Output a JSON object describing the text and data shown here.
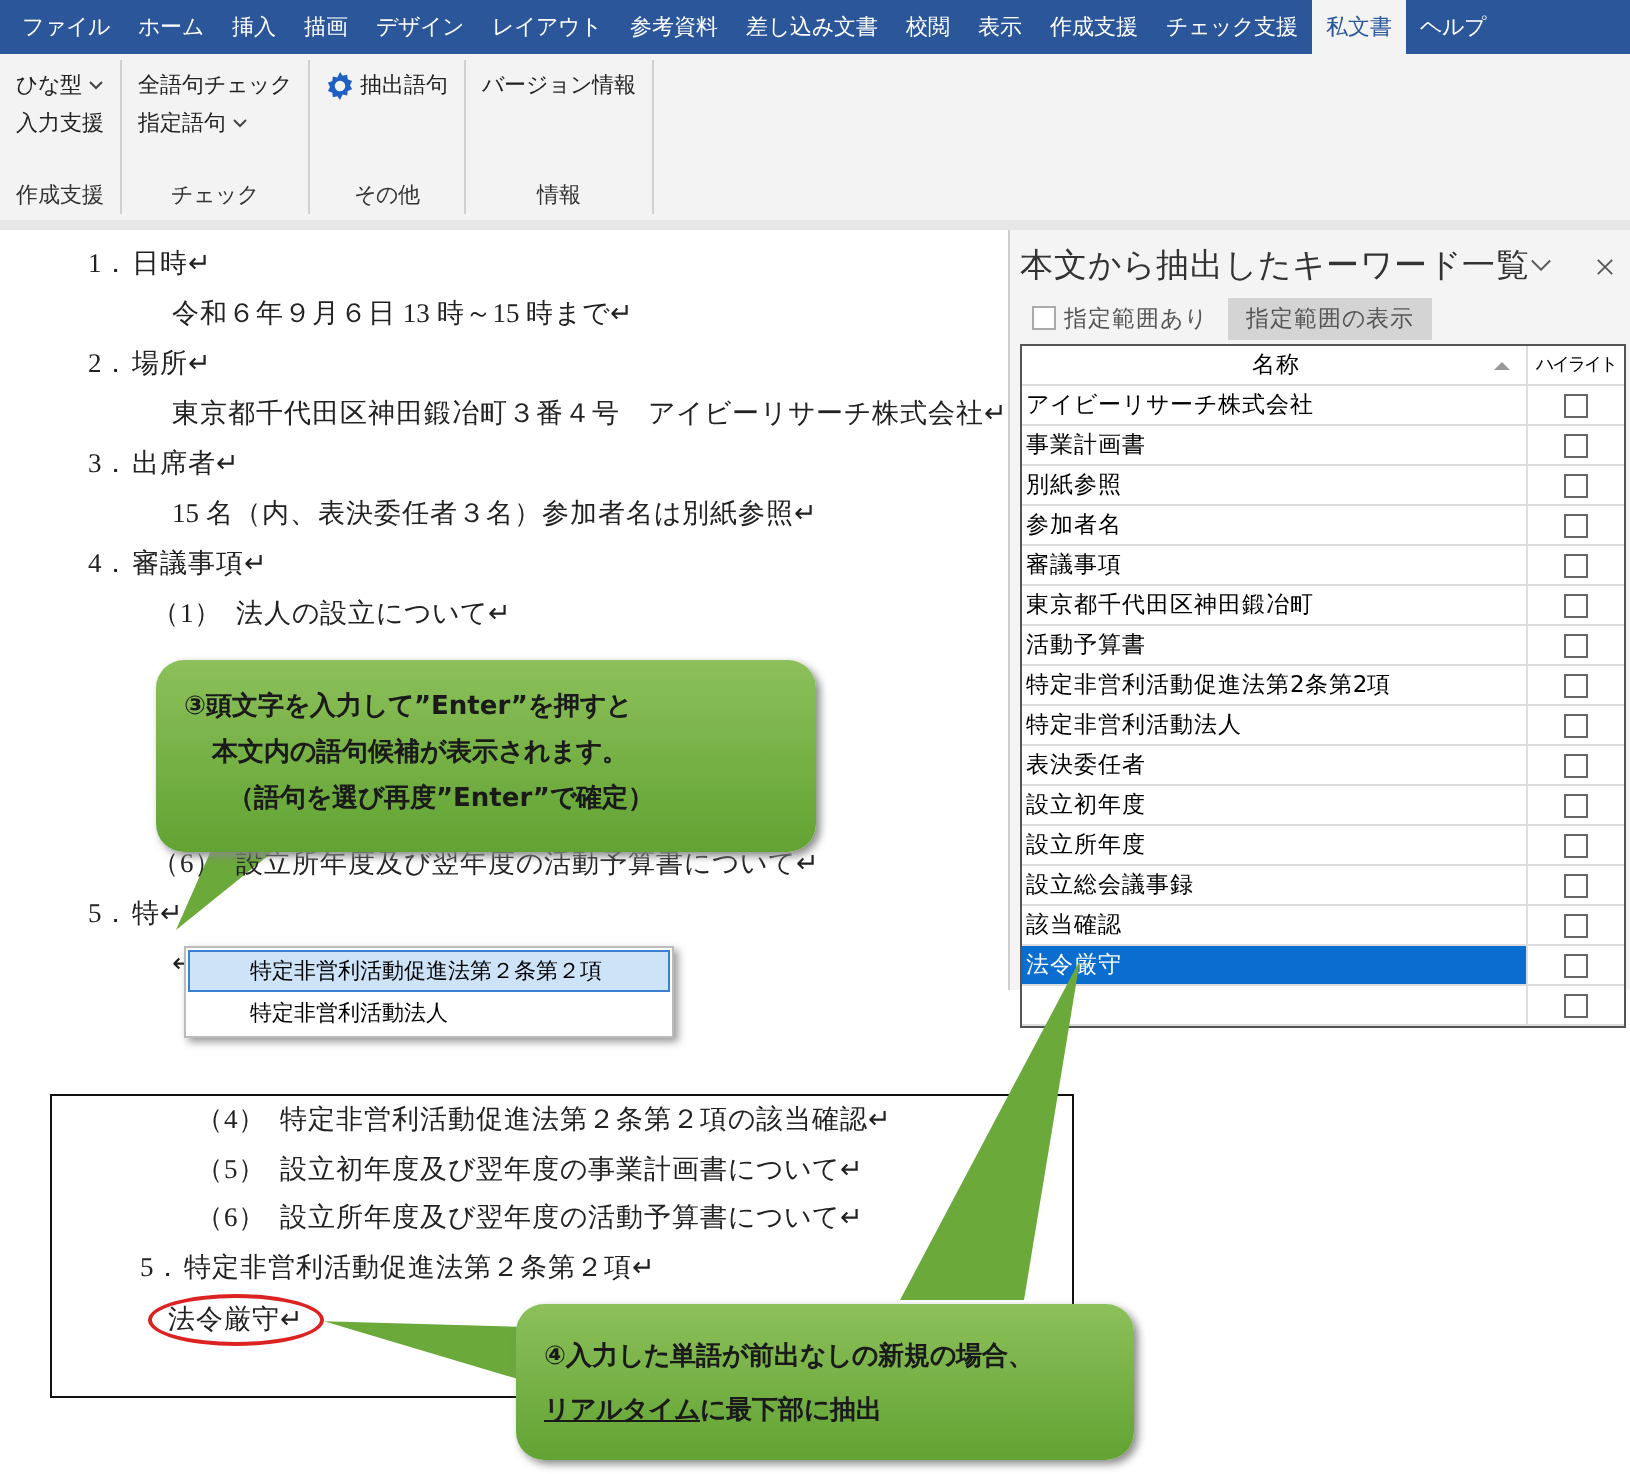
{
  "tabs": [
    {
      "label": "ファイル",
      "selected": false
    },
    {
      "label": "ホーム",
      "selected": false
    },
    {
      "label": "挿入",
      "selected": false
    },
    {
      "label": "描画",
      "selected": false
    },
    {
      "label": "デザイン",
      "selected": false
    },
    {
      "label": "レイアウト",
      "selected": false
    },
    {
      "label": "参考資料",
      "selected": false
    },
    {
      "label": "差し込み文書",
      "selected": false
    },
    {
      "label": "校閲",
      "selected": false
    },
    {
      "label": "表示",
      "selected": false
    },
    {
      "label": "作成支援",
      "selected": false
    },
    {
      "label": "チェック支援",
      "selected": false
    },
    {
      "label": "私文書",
      "selected": true
    },
    {
      "label": "ヘルプ",
      "selected": false
    }
  ],
  "ribbon_groups": [
    {
      "label": "作成支援",
      "items": [
        {
          "label": "ひな型",
          "kind": "dropdown"
        },
        {
          "label": "入力支援",
          "kind": "button"
        }
      ]
    },
    {
      "label": "チェック",
      "items": [
        {
          "label": "全語句チェック",
          "kind": "button"
        },
        {
          "label": "指定語句",
          "kind": "dropdown"
        }
      ]
    },
    {
      "label": "その他",
      "items": [
        {
          "label": "抽出語句",
          "kind": "gear"
        }
      ]
    },
    {
      "label": "情報",
      "items": [
        {
          "label": "バージョン情報",
          "kind": "button"
        }
      ]
    }
  ],
  "document_top": [
    {
      "kind": "heading",
      "number": "1．",
      "text": "日時↵"
    },
    {
      "kind": "body",
      "text": "令和６年９月６日 13 時～15 時まで↵"
    },
    {
      "kind": "heading",
      "number": "2．",
      "text": "場所↵"
    },
    {
      "kind": "body",
      "text": "東京都千代田区神田鍛冶町３番４号　アイビーリサーチ株式会社↵"
    },
    {
      "kind": "heading",
      "number": "3．",
      "text": "出席者↵"
    },
    {
      "kind": "body",
      "text": "15 名（内、表決委任者３名）参加者名は別紙参照↵"
    },
    {
      "kind": "heading",
      "number": "4．",
      "text": "審議事項↵"
    },
    {
      "kind": "sub",
      "number": "（1）",
      "text": "法人の設立について↵"
    }
  ],
  "document_bottom": [
    {
      "kind": "sub",
      "number": "（6）",
      "text": "設立所年度及び翌年度の活動予算書について↵"
    },
    {
      "kind": "heading",
      "number": "5．",
      "text": "特↵"
    },
    {
      "kind": "body",
      "text": "↵"
    }
  ],
  "suggestions": [
    {
      "label": "特定非営利活動促進法第２条第２項",
      "selected": true
    },
    {
      "label": "特定非営利活動法人",
      "selected": false
    }
  ],
  "result_box": [
    {
      "kind": "sub",
      "number": "（4）",
      "text": "特定非営利活動促進法第２条第２項の該当確認↵"
    },
    {
      "kind": "sub",
      "number": "（5）",
      "text": "設立初年度及び翌年度の事業計画書について↵"
    },
    {
      "kind": "sub",
      "number": "（6）",
      "text": "設立所年度及び翌年度の活動予算書について↵"
    },
    {
      "kind": "heading",
      "number": "5．",
      "text": "特定非営利活動促進法第２条第２項↵"
    },
    {
      "kind": "circled",
      "text": "法令厳守↵"
    }
  ],
  "callout_1": [
    "③頭文字を入力して”Enter”を押すと",
    "本文内の語句候補が表示されます。",
    "（語句を選び再度”Enter”で確定）"
  ],
  "callout_2": {
    "line_1": "④入力した単語が前出なしの新規の場合、",
    "line_2": [
      {
        "text": "リアルタイム",
        "underline": true
      },
      {
        "text": "に最下部に抽出",
        "underline": false
      }
    ]
  },
  "panel": {
    "title": "本文から抽出したキーワード一覧",
    "range_checkbox": {
      "label": "指定範囲あり",
      "checked": false
    },
    "range_button": "指定範囲の表示",
    "columns": [
      "名称",
      "ハイライト"
    ],
    "rows": [
      {
        "name": "アイビーリサーチ株式会社",
        "highlight": false,
        "selected": false
      },
      {
        "name": "事業計画書",
        "highlight": false,
        "selected": false
      },
      {
        "name": "別紙参照",
        "highlight": false,
        "selected": false
      },
      {
        "name": "参加者名",
        "highlight": false,
        "selected": false
      },
      {
        "name": "審議事項",
        "highlight": false,
        "selected": false
      },
      {
        "name": "東京都千代田区神田鍛冶町",
        "highlight": false,
        "selected": false
      },
      {
        "name": "活動予算書",
        "highlight": false,
        "selected": false
      },
      {
        "name": "特定非営利活動促進法第2条第2項",
        "highlight": false,
        "selected": false
      },
      {
        "name": "特定非営利活動法人",
        "highlight": false,
        "selected": false
      },
      {
        "name": "表決委任者",
        "highlight": false,
        "selected": false
      },
      {
        "name": "設立初年度",
        "highlight": false,
        "selected": false
      },
      {
        "name": "設立所年度",
        "highlight": false,
        "selected": false
      },
      {
        "name": "設立総会議事録",
        "highlight": false,
        "selected": false
      },
      {
        "name": "該当確認",
        "highlight": false,
        "selected": false
      },
      {
        "name": "法令厳守",
        "highlight": false,
        "selected": true
      },
      {
        "highlight": false,
        "selected": false
      }
    ]
  }
}
